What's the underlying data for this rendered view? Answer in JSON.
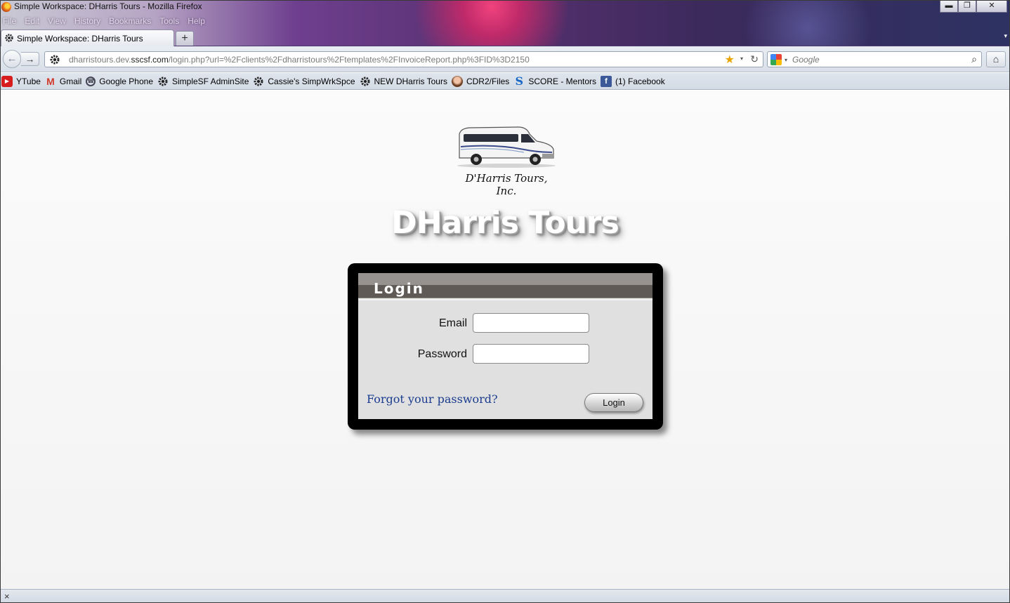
{
  "window": {
    "title": "Simple Workspace: DHarris Tours - Mozilla Firefox",
    "controls": {
      "minimize": "▬",
      "maximize": "❐",
      "close": "✕"
    }
  },
  "menu": [
    "File",
    "Edit",
    "View",
    "History",
    "Bookmarks",
    "Tools",
    "Help"
  ],
  "tab": {
    "label": "Simple Workspace: DHarris Tours",
    "new_tab_label": "+",
    "list_arrow": "▾"
  },
  "nav": {
    "back": "←",
    "forward": "→",
    "url_domain": "dharristours.dev.",
    "url_host": "sscsf.com",
    "url_path": "/login.php?url=%2Fclients%2Fdharristours%2Ftemplates%2FInvoiceReport.php%3FID%3D2150",
    "star": "★",
    "dropdown": "▾",
    "reload": "↻",
    "search_placeholder": "Google",
    "search_go": "⌕",
    "home": "⌂"
  },
  "bookmarks": [
    {
      "label": "YTube",
      "icon": "youtube-icon",
      "glyph": "▶"
    },
    {
      "label": "Gmail",
      "icon": "gmail-icon",
      "glyph": "M"
    },
    {
      "label": "Google Phone",
      "icon": "phone-icon",
      "glyph": "☎"
    },
    {
      "label": "SimpleSF AdminSite",
      "icon": "gear-icon",
      "glyph": "⚙"
    },
    {
      "label": "Cassie's SimpWrkSpce",
      "icon": "gear-icon",
      "glyph": "⚙"
    },
    {
      "label": "NEW DHarris Tours",
      "icon": "gear-icon",
      "glyph": "⚙"
    },
    {
      "label": "CDR2/Files",
      "icon": "avatar-icon",
      "glyph": ""
    },
    {
      "label": "SCORE - Mentors",
      "icon": "score-icon",
      "glyph": "S"
    },
    {
      "label": "(1) Facebook",
      "icon": "facebook-icon",
      "glyph": "f"
    }
  ],
  "page": {
    "logo_text": "D'Harris Tours, Inc.",
    "brand_title": "DHarris Tours",
    "login": {
      "heading": "Login",
      "email_label": "Email",
      "email_value": "",
      "password_label": "Password",
      "password_value": "",
      "forgot_link": "Forgot your password?",
      "submit_label": "Login"
    }
  },
  "status": {
    "close": "×"
  }
}
